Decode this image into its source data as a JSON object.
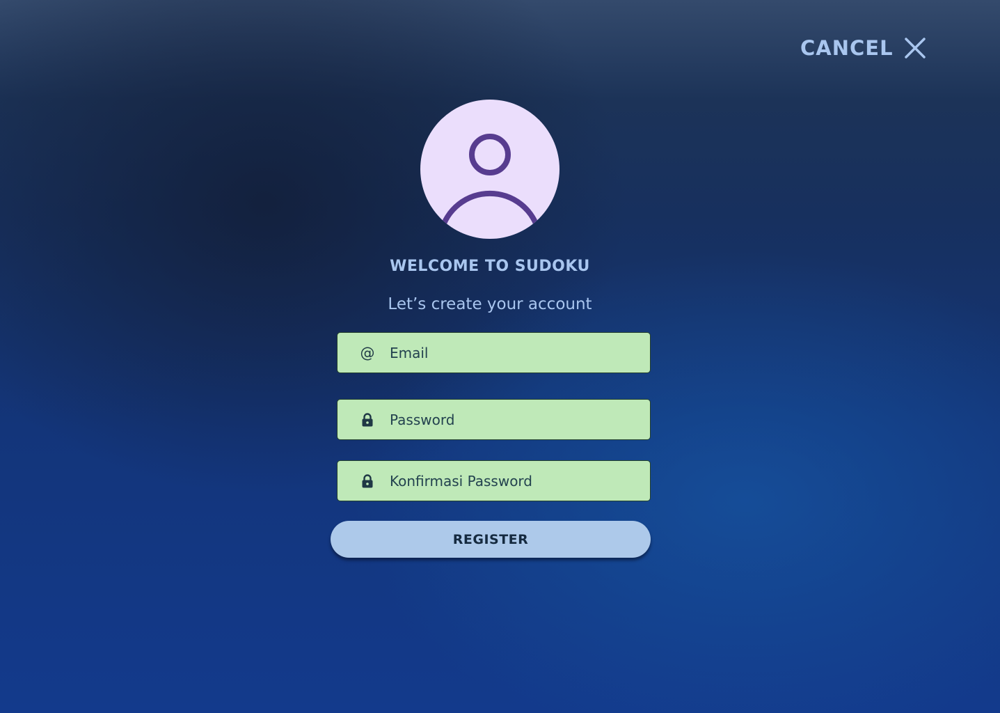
{
  "header": {
    "cancel_label": "CANCEL",
    "cancel_icon": "close-icon"
  },
  "avatar": {
    "icon": "user-avatar-icon",
    "background_color": "#ebdefc",
    "stroke_color": "#573c8f"
  },
  "form": {
    "title": "WELCOME TO SUDOKU",
    "subtitle": "Let’s create your account",
    "fields": [
      {
        "icon": "at-icon",
        "placeholder": "Email",
        "value": ""
      },
      {
        "icon": "lock-icon",
        "placeholder": "Password",
        "value": ""
      },
      {
        "icon": "lock-icon",
        "placeholder": "Konfirmasi Password",
        "value": ""
      }
    ],
    "register_label": "REGISTER"
  },
  "colors": {
    "accent_text": "#a9c6ef",
    "field_background": "#bfe9b8",
    "button_background": "#adc9ea"
  }
}
